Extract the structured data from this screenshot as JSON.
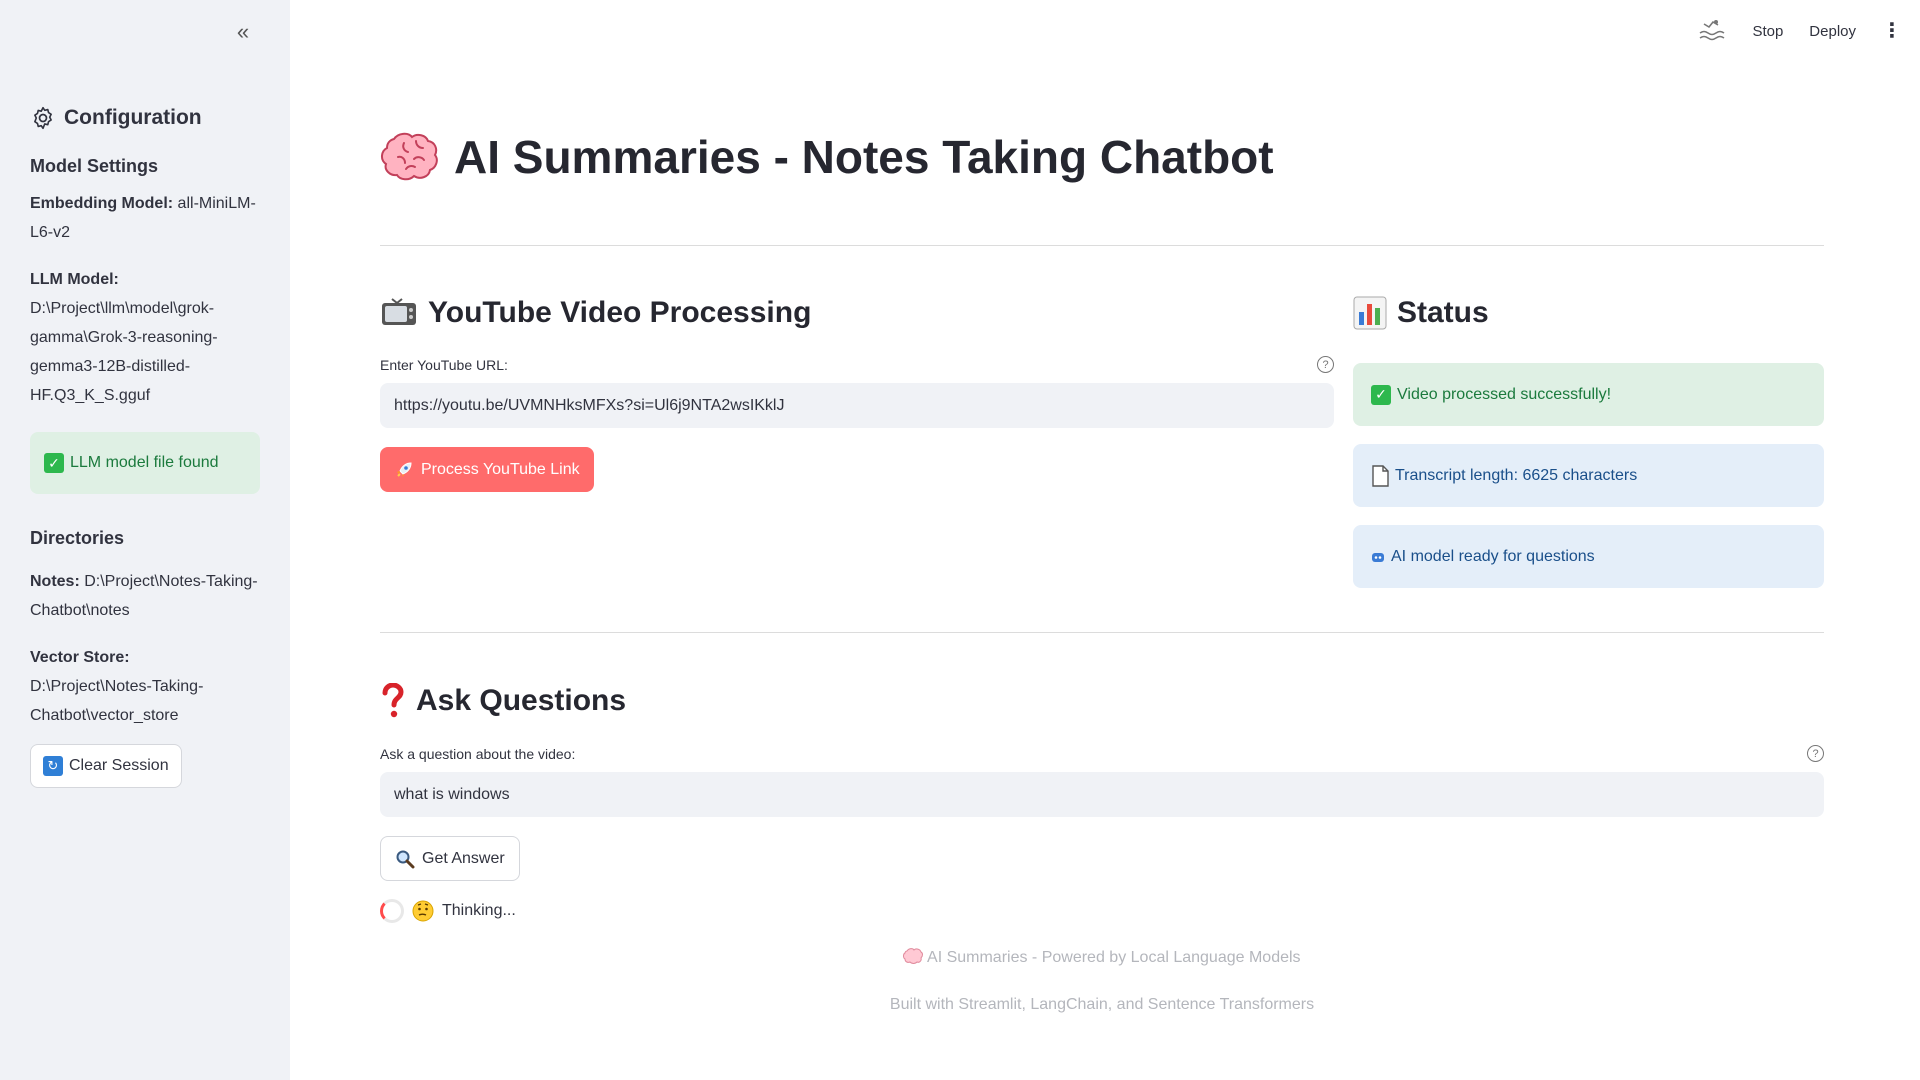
{
  "sidebar": {
    "header": "Configuration",
    "model_settings_title": "Model Settings",
    "embedding_label": "Embedding Model:",
    "embedding_value": " all-MiniLM-L6-v2",
    "llm_label": "LLM Model:",
    "llm_value": "D:\\Project\\llm\\model\\grok-gamma\\Grok-3-reasoning-gemma3-12B-distilled-HF.Q3_K_S.gguf",
    "llm_found": "LLM model file found",
    "directories_title": "Directories",
    "notes_label": "Notes:",
    "notes_value": " D:\\Project\\Notes-Taking-Chatbot\\notes",
    "vector_label": "Vector Store:",
    "vector_value": " D:\\Project\\Notes-Taking-Chatbot\\vector_store",
    "clear_button": "Clear Session"
  },
  "toolbar": {
    "stop": "Stop",
    "deploy": "Deploy"
  },
  "main": {
    "title": "AI Summaries - Notes Taking Chatbot",
    "youtube_section": "YouTube Video Processing",
    "url_label": "Enter YouTube URL:",
    "url_value": "https://youtu.be/UVMNHksMFXs?si=Ul6j9NTA2wsIKklJ",
    "process_button": "Process YouTube Link",
    "status_title": "Status",
    "status_messages": [
      "Video processed successfully!",
      "Transcript length: 6625 characters",
      "AI model ready for questions"
    ],
    "ask_title": "Ask Questions",
    "question_label": "Ask a question about the video:",
    "question_value": "what is windows",
    "answer_button": "Get Answer",
    "thinking": "Thinking..."
  },
  "footer": {
    "line1": "AI Summaries - Powered by Local Language Models",
    "line2": "Built with Streamlit, LangChain, and Sentence Transformers"
  },
  "colors": {
    "primary": "#ff6b6b",
    "success_bg": "#dff0e4",
    "info_bg": "#e4eef9",
    "sidebar_bg": "#f0f2f6"
  }
}
